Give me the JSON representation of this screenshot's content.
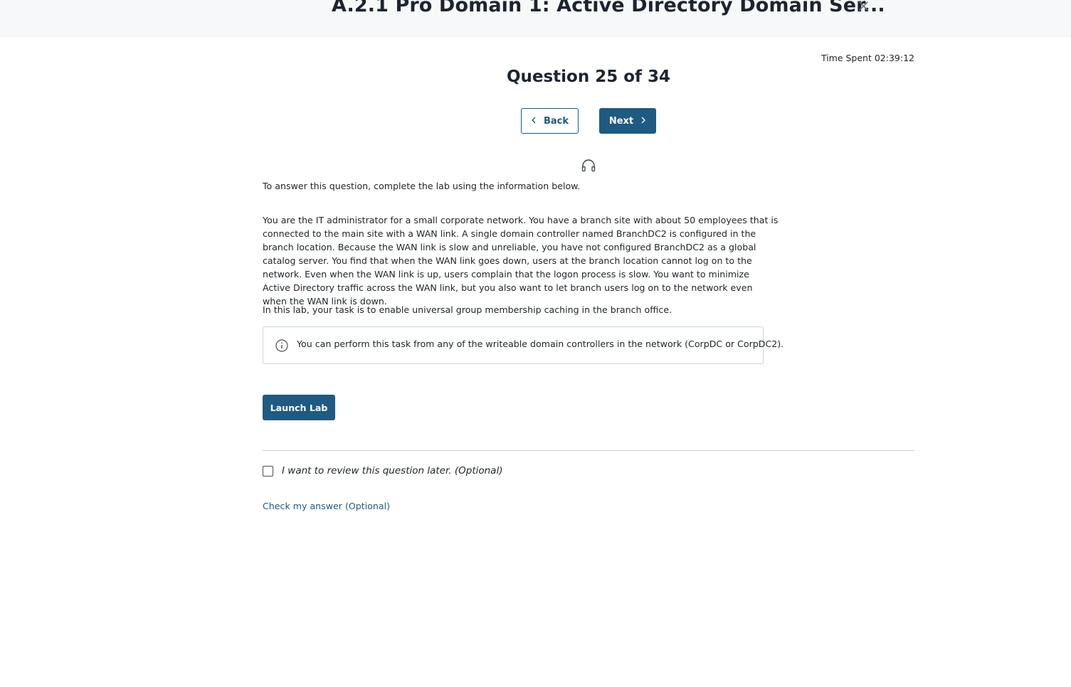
{
  "header": {
    "title": "A.2.1 Pro Domain 1: Active Directory Domain Ser...",
    "close_icon": "close-icon"
  },
  "timer": {
    "text": "Time Spent 02:39:12"
  },
  "question": {
    "heading": "Question 25 of 34"
  },
  "nav": {
    "back_label": "Back",
    "next_label": "Next"
  },
  "audio_icon": "headphones-icon",
  "body": {
    "intro": "To answer this question, complete the lab using the information below.",
    "scenario": "You are the IT administrator for a small corporate network. You have a branch site with about 50 employees that is connected to the main site with a WAN link. A single domain controller named BranchDC2 is configured in the branch location. Because the WAN link is slow and unreliable, you have not configured BranchDC2 as a global catalog server. You find that when the WAN link goes down, users at the branch location cannot log on to the network. Even when the WAN link is up, users complain that the logon process is slow. You want to minimize Active Directory traffic across the WAN link, but you also want to let branch users log on to the network even when the WAN link is down.",
    "task": "In this lab, your task is to enable universal group membership caching in the branch office."
  },
  "note": {
    "icon": "info-icon",
    "text": "You can perform this task from any of the writeable domain controllers in the network (CorpDC or CorpDC2)."
  },
  "launch": {
    "label": "Launch Lab"
  },
  "review": {
    "label": "I want to review this question later. (Optional)",
    "checked": false
  },
  "check_answer": {
    "label": "Check my answer (Optional)"
  },
  "colors": {
    "primary": "#1e5a82",
    "topbar_bg": "#f7f8f9",
    "text": "#1f2328",
    "border": "#cfd4d9"
  }
}
